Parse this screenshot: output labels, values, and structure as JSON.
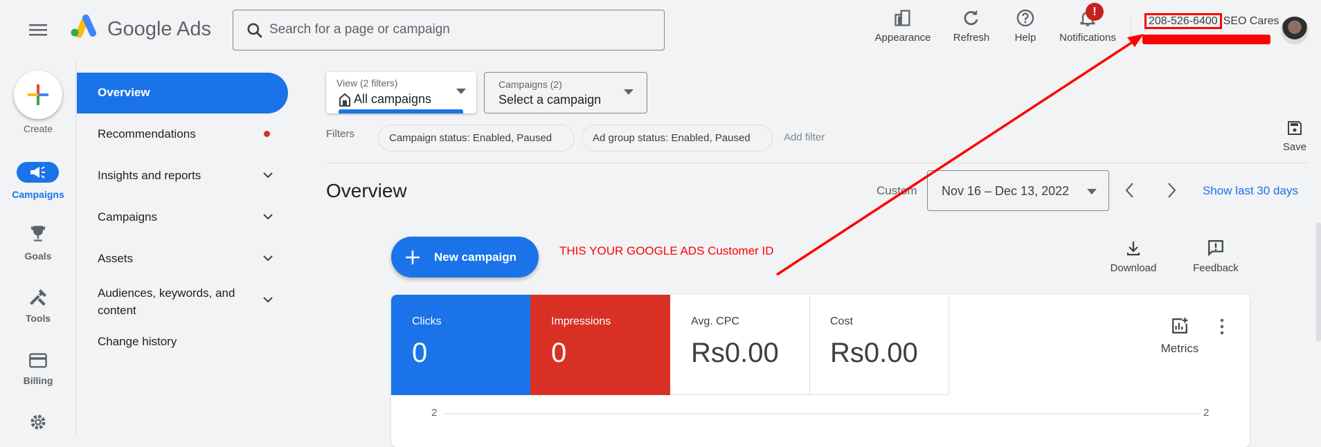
{
  "header": {
    "app_name": "Google Ads",
    "search_placeholder": "Search for a page or campaign",
    "actions": [
      {
        "label": "Appearance",
        "icon": "appearance-icon"
      },
      {
        "label": "Refresh",
        "icon": "refresh-icon"
      },
      {
        "label": "Help",
        "icon": "help-icon"
      },
      {
        "label": "Notifications",
        "icon": "bell-icon",
        "badge": "!"
      }
    ],
    "customer_id": "208-526-6400",
    "account_name": "SEO Cares"
  },
  "rail": {
    "create": "Create",
    "items": [
      {
        "label": "Campaigns",
        "active": true
      },
      {
        "label": "Goals"
      },
      {
        "label": "Tools"
      },
      {
        "label": "Billing"
      }
    ]
  },
  "nav": {
    "items": [
      {
        "label": "Overview",
        "active": true
      },
      {
        "label": "Recommendations",
        "dot": true
      },
      {
        "label": "Insights and reports",
        "expandable": true
      },
      {
        "label": "Campaigns",
        "expandable": true
      },
      {
        "label": "Assets",
        "expandable": true
      },
      {
        "label": "Audiences, keywords, and content",
        "expandable": true
      },
      {
        "label": "Change history"
      }
    ]
  },
  "filters": {
    "view_label": "View (2 filters)",
    "view_value": "All campaigns",
    "campaigns_label": "Campaigns (2)",
    "campaigns_value": "Select a campaign",
    "filters_label": "Filters",
    "chips": [
      "Campaign status: Enabled, Paused",
      "Ad group status: Enabled, Paused"
    ],
    "add_filter": "Add filter",
    "save": "Save"
  },
  "overview": {
    "title": "Overview",
    "range_label": "Custom",
    "date_range": "Nov 16 – Dec 13, 2022",
    "show_last": "Show last 30 days",
    "new_campaign": "New campaign",
    "download": "Download",
    "feedback": "Feedback",
    "metrics": "Metrics",
    "tiles": [
      {
        "title": "Clicks",
        "value": "0",
        "color": "#1a73e8"
      },
      {
        "title": "Impressions",
        "value": "0",
        "color": "#d93025"
      },
      {
        "title": "Avg. CPC",
        "value": "Rs0.00"
      },
      {
        "title": "Cost",
        "value": "Rs0.00"
      }
    ],
    "axis_left": "2",
    "axis_right": "2"
  },
  "annotation": {
    "text": "THIS YOUR GOOGLE ADS Customer ID",
    "color": "#ff0000"
  }
}
